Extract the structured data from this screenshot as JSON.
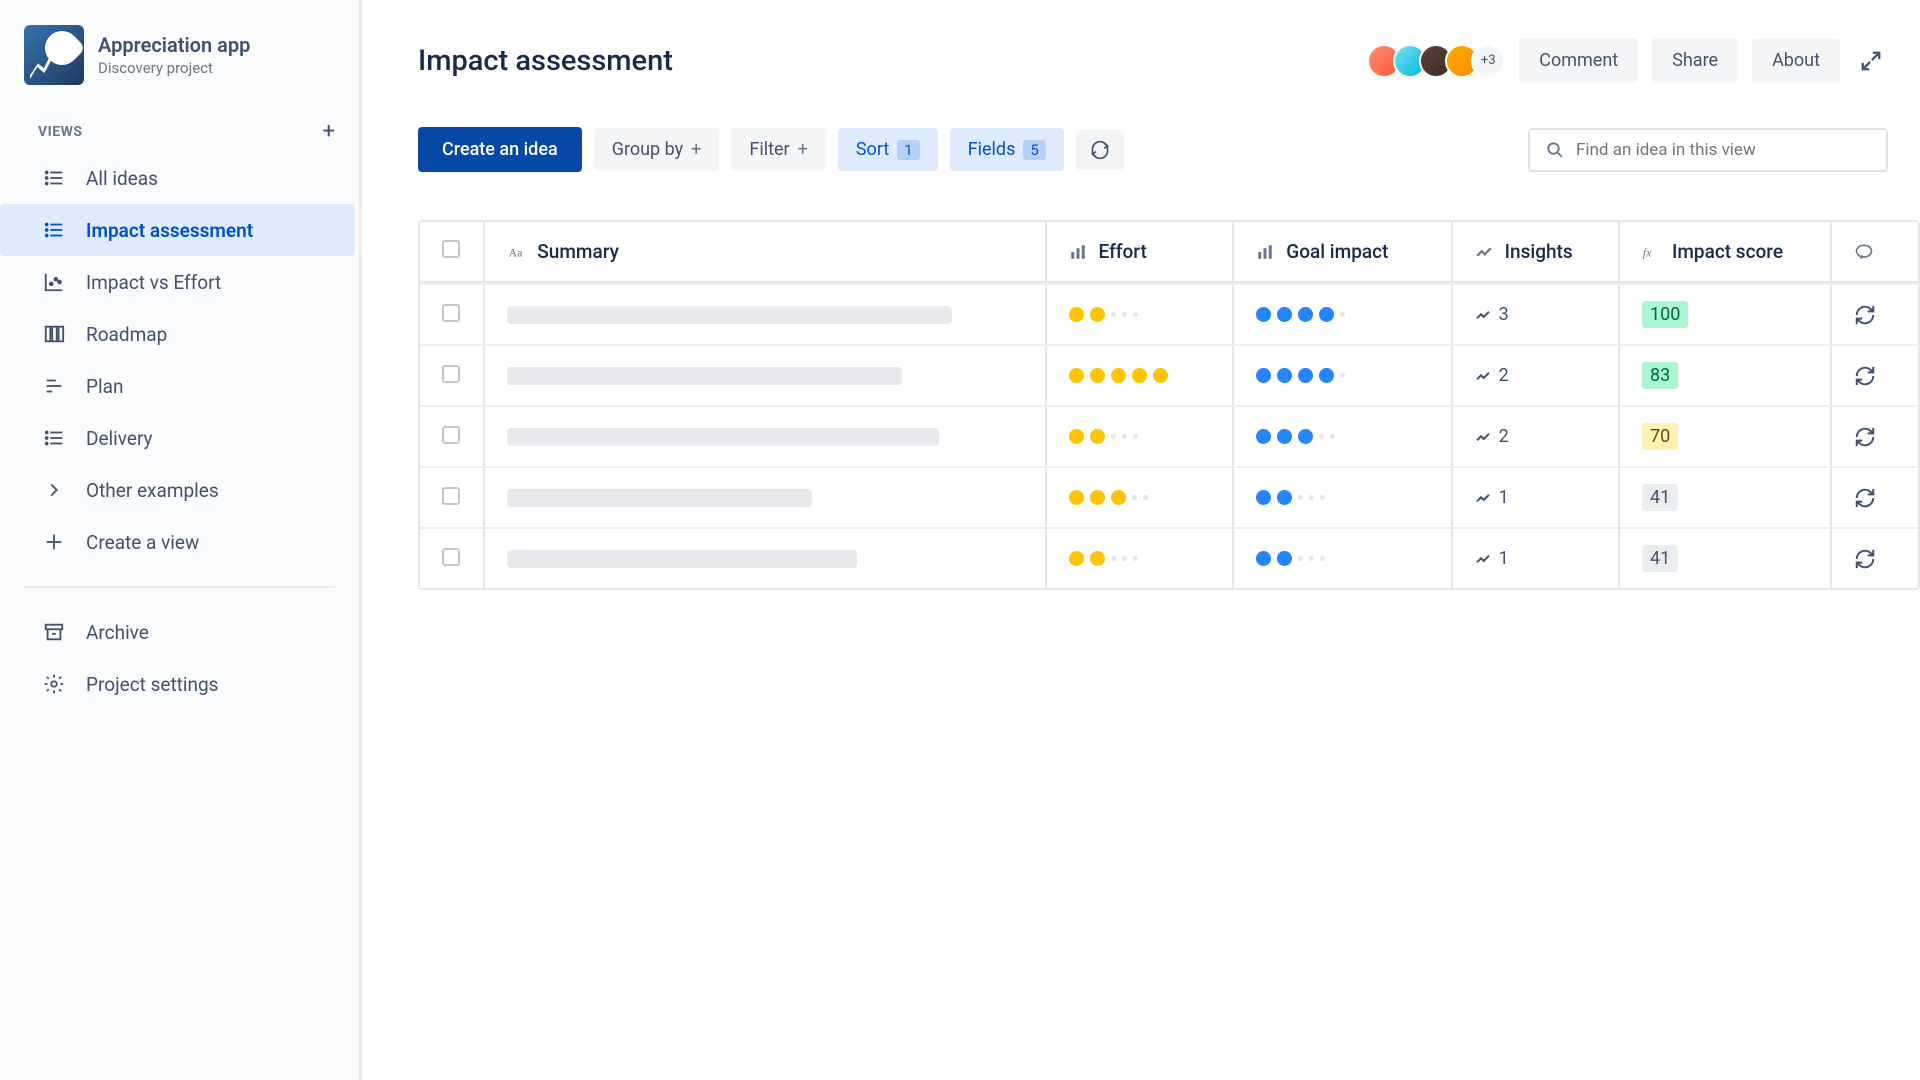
{
  "project": {
    "title": "Appreciation app",
    "subtitle": "Discovery project"
  },
  "sidebar": {
    "section_label": "VIEWS",
    "items": [
      {
        "label": "All ideas",
        "icon": "list"
      },
      {
        "label": "Impact assessment",
        "icon": "list",
        "active": true
      },
      {
        "label": "Impact vs Effort",
        "icon": "scatter"
      },
      {
        "label": "Roadmap",
        "icon": "board"
      },
      {
        "label": "Plan",
        "icon": "plan"
      },
      {
        "label": "Delivery",
        "icon": "list"
      },
      {
        "label": "Other examples",
        "icon": "chevron"
      },
      {
        "label": "Create a view",
        "icon": "plus"
      }
    ],
    "footer": [
      {
        "label": "Archive",
        "icon": "archive"
      },
      {
        "label": "Project settings",
        "icon": "gear"
      }
    ]
  },
  "header": {
    "title": "Impact assessment",
    "avatar_more": "+3",
    "comment_label": "Comment",
    "share_label": "Share",
    "about_label": "About"
  },
  "toolbar": {
    "create_label": "Create an idea",
    "groupby_label": "Group by",
    "filter_label": "Filter",
    "sort_label": "Sort",
    "sort_count": "1",
    "fields_label": "Fields",
    "fields_count": "5",
    "search_placeholder": "Find an idea in this view"
  },
  "table": {
    "columns": {
      "summary": "Summary",
      "effort": "Effort",
      "goal_impact": "Goal impact",
      "insights": "Insights",
      "impact_score": "Impact score"
    },
    "rows": [
      {
        "summary_width": 445,
        "effort": 2,
        "goal_impact": 4,
        "insights": "3",
        "score": "100",
        "score_class": "score-green"
      },
      {
        "summary_width": 395,
        "effort": 5,
        "goal_impact": 4,
        "insights": "2",
        "score": "83",
        "score_class": "score-green"
      },
      {
        "summary_width": 432,
        "effort": 2,
        "goal_impact": 3,
        "insights": "2",
        "score": "70",
        "score_class": "score-yellow"
      },
      {
        "summary_width": 305,
        "effort": 3,
        "goal_impact": 2,
        "insights": "1",
        "score": "41",
        "score_class": "score-gray"
      },
      {
        "summary_width": 350,
        "effort": 2,
        "goal_impact": 2,
        "insights": "1",
        "score": "41",
        "score_class": "score-gray"
      }
    ]
  }
}
